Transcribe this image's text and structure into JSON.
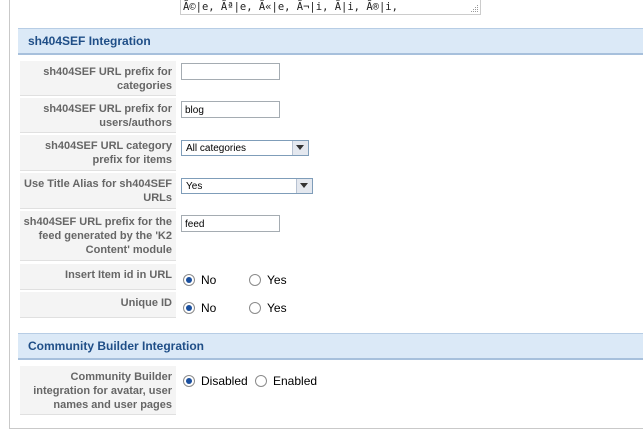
{
  "top_textarea": {
    "value": "Ã©|e, Ãª|e, Ã«|e, Ã¬|i, Ã|i, Ã®|i,"
  },
  "sh404sef": {
    "header": "sh404SEF Integration",
    "rows": [
      {
        "label": "sh404SEF URL prefix for categories",
        "value": ""
      },
      {
        "label": "sh404SEF URL prefix for users/authors",
        "value": "blog"
      },
      {
        "label": "sh404SEF URL category prefix for items",
        "value": "All categories"
      },
      {
        "label": "Use Title Alias for sh404SEF URLs",
        "value": "Yes"
      },
      {
        "label": "sh404SEF URL prefix for the feed generated by the 'K2 Content' module",
        "value": "feed"
      },
      {
        "label": "Insert Item id in URL",
        "options": [
          "No",
          "Yes"
        ],
        "selected": "No"
      },
      {
        "label": "Unique ID",
        "options": [
          "No",
          "Yes"
        ],
        "selected": "No"
      }
    ]
  },
  "community_builder": {
    "header": "Community Builder Integration",
    "label": "Community Builder integration for avatar, user names and user pages",
    "options": [
      "Disabled",
      "Enabled"
    ],
    "selected": "Disabled"
  }
}
